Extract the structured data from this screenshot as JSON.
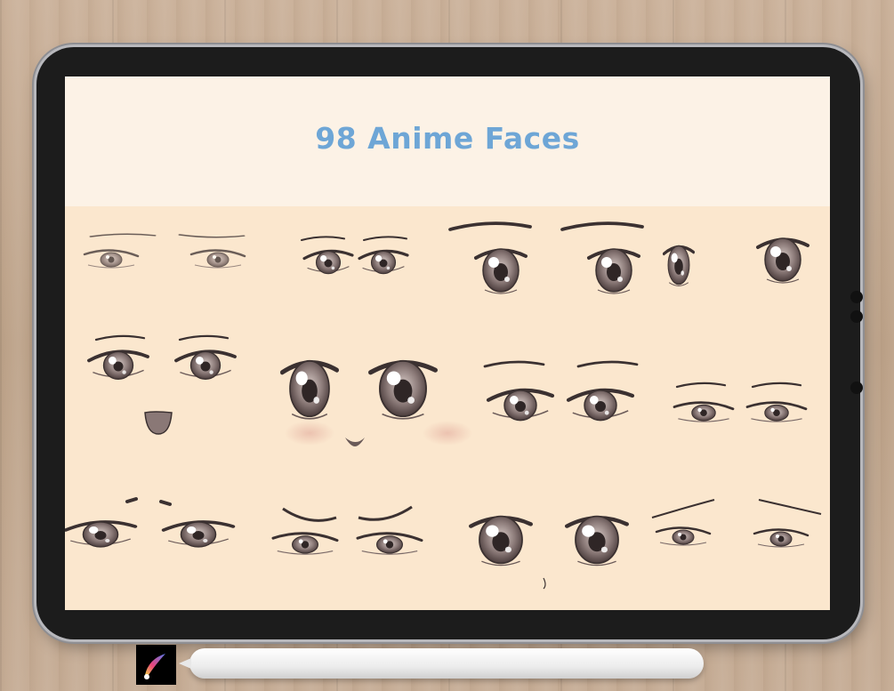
{
  "title": "98 Anime Faces",
  "colors": {
    "title": "#6ea6d6",
    "screen_background": "#fbe7ce",
    "header_background": "#fcf2e6",
    "eye_ink": "#3b3131"
  },
  "icons": [
    "procreate-app-icon",
    "apple-pencil"
  ]
}
